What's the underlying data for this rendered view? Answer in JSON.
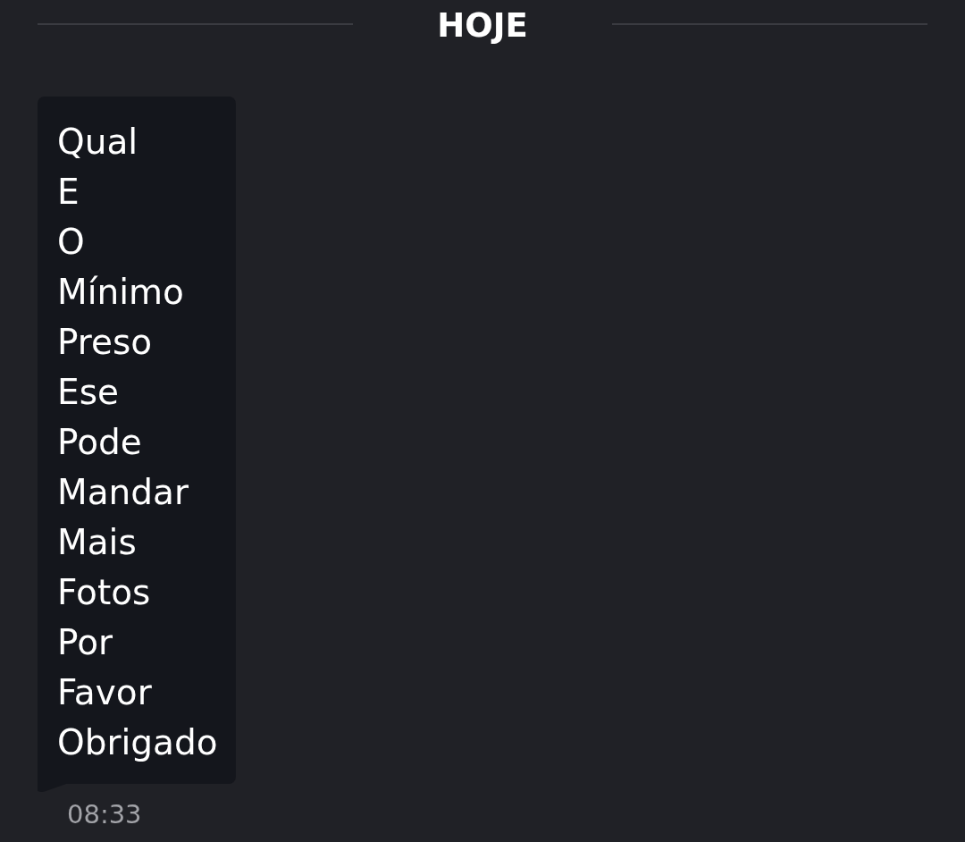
{
  "date_divider": {
    "label": "HOJE"
  },
  "messages": [
    {
      "kind": "received",
      "text": "Qual\nE\nO\nMínimo\nPreso\nEse\nPode\nMandar\nMais\nFotos\nPor\nFavor\nObrigado",
      "time": "08:33"
    }
  ]
}
